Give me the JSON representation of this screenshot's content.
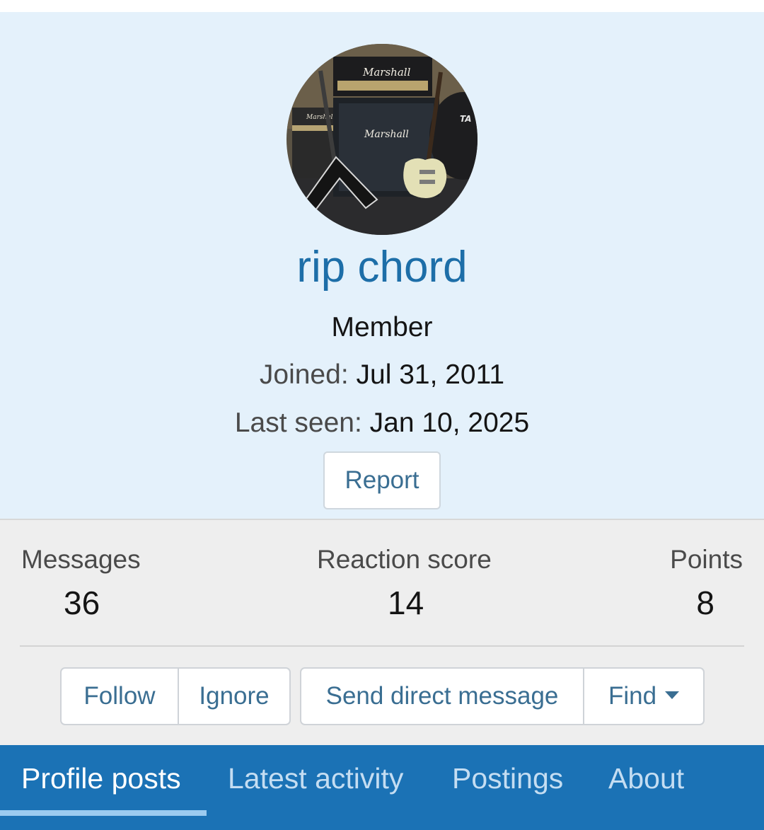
{
  "profile": {
    "username": "rip chord",
    "role": "Member",
    "joined_label": "Joined:",
    "joined_value": "Jul 31, 2011",
    "last_seen_label": "Last seen:",
    "last_seen_value": "Jan 10, 2025",
    "report_label": "Report",
    "avatar": {
      "description_icon": "avatar-photo",
      "brand_text": "Marshall",
      "drum_text": "TA"
    }
  },
  "stats": [
    {
      "label": "Messages",
      "value": "36"
    },
    {
      "label": "Reaction score",
      "value": "14"
    },
    {
      "label": "Points",
      "value": "8"
    }
  ],
  "actions": {
    "follow_label": "Follow",
    "ignore_label": "Ignore",
    "dm_label": "Send direct message",
    "find_label": "Find",
    "find_icon": "caret-down-icon"
  },
  "tabs": [
    {
      "label": "Profile posts",
      "active": true
    },
    {
      "label": "Latest activity",
      "active": false
    },
    {
      "label": "Postings",
      "active": false
    },
    {
      "label": "About",
      "active": false
    }
  ],
  "colors": {
    "banner_bg": "#e4f1fb",
    "username": "#1d6ea8",
    "stats_bg": "#eeeeee",
    "button_text": "#3a6e92",
    "tabbar_bg": "#1b72b5",
    "tab_underline": "#9ccbf0"
  }
}
